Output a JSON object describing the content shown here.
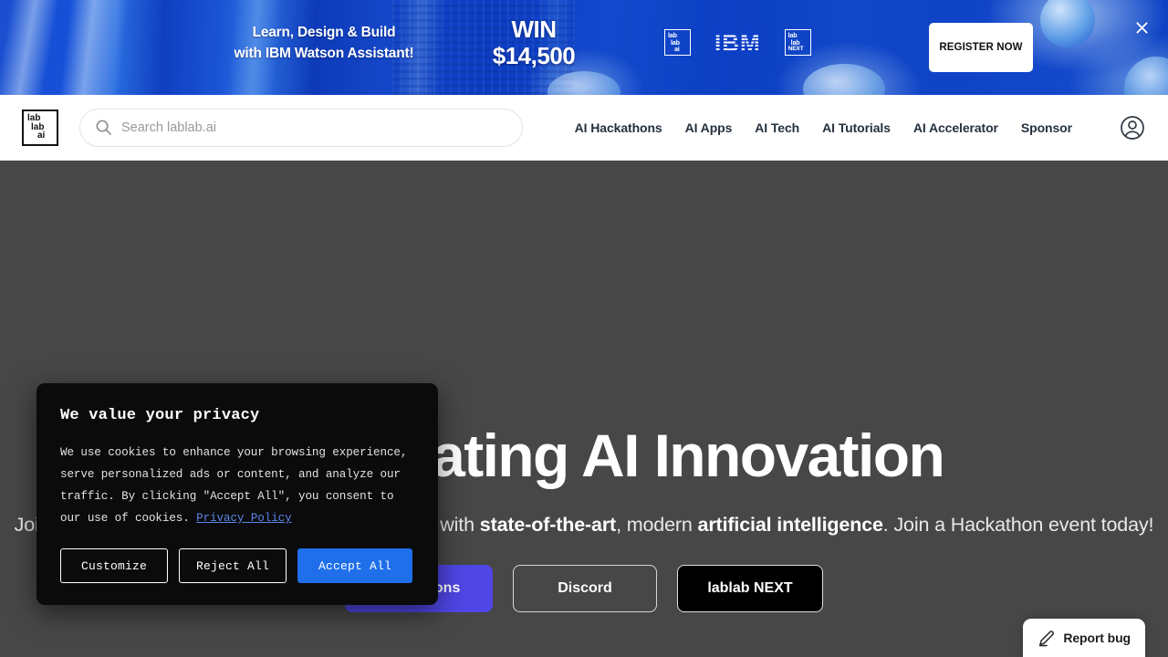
{
  "promo_banner": {
    "headline_line1": "Learn, Design & Build",
    "headline_line2": "with IBM Watson Assistant!",
    "prize_label": "WIN",
    "prize_amount": "$14,500",
    "logos": [
      {
        "name": "lablab-ai-logo",
        "line1": "lab",
        "line2": "lab",
        "line3": "ai"
      },
      {
        "name": "ibm-logo",
        "text": "IBM"
      },
      {
        "name": "lablab-next-logo",
        "line1": "lab",
        "line2": "lab",
        "line3": "NEXT"
      }
    ],
    "cta_label": "REGISTER NOW",
    "close_icon": "close-icon",
    "background_color": "#0f44c6",
    "cta_bg": "#ffffff"
  },
  "navbar": {
    "logo": {
      "line1": "lab",
      "line2": "lab",
      "line3": "ai"
    },
    "search": {
      "placeholder": "Search lablab.ai",
      "value": "",
      "icon": "search-icon"
    },
    "links": [
      {
        "label": "AI Hackathons"
      },
      {
        "label": "AI Apps"
      },
      {
        "label": "AI Tech"
      },
      {
        "label": "AI Tutorials"
      },
      {
        "label": "AI Accelerator"
      },
      {
        "label": "Sponsor"
      }
    ],
    "account_icon": "user-circle-icon"
  },
  "hero": {
    "title": "Accelerating AI Innovation",
    "subtitle_html": "Join the community of 395,000+ makers, building with <b>state-of-the-art</b>, modern <b>artificial intelligence</b>. Join a Hackathon event today!",
    "buttons": [
      {
        "label": "Hackathons",
        "style": "primary",
        "color": "#4f46e5"
      },
      {
        "label": "Discord",
        "style": "ghost"
      },
      {
        "label": "lablab NEXT",
        "style": "dark",
        "color": "#000000"
      }
    ],
    "background_color": "#474747"
  },
  "cookie_dialog": {
    "title": "We value your privacy",
    "body_part1": "We use cookies to enhance your browsing experience, serve personalized ads or content, and analyze our traffic. By clicking \"Accept All\", you consent to our use of cookies.",
    "link_label": "Privacy Policy",
    "buttons": {
      "customize": "Customize",
      "reject": "Reject All",
      "accept": "Accept All"
    },
    "accept_color": "#1f6feb",
    "background_color": "#0b0b0b"
  },
  "report_bug": {
    "label": "Report bug",
    "icon": "pencil-icon"
  }
}
